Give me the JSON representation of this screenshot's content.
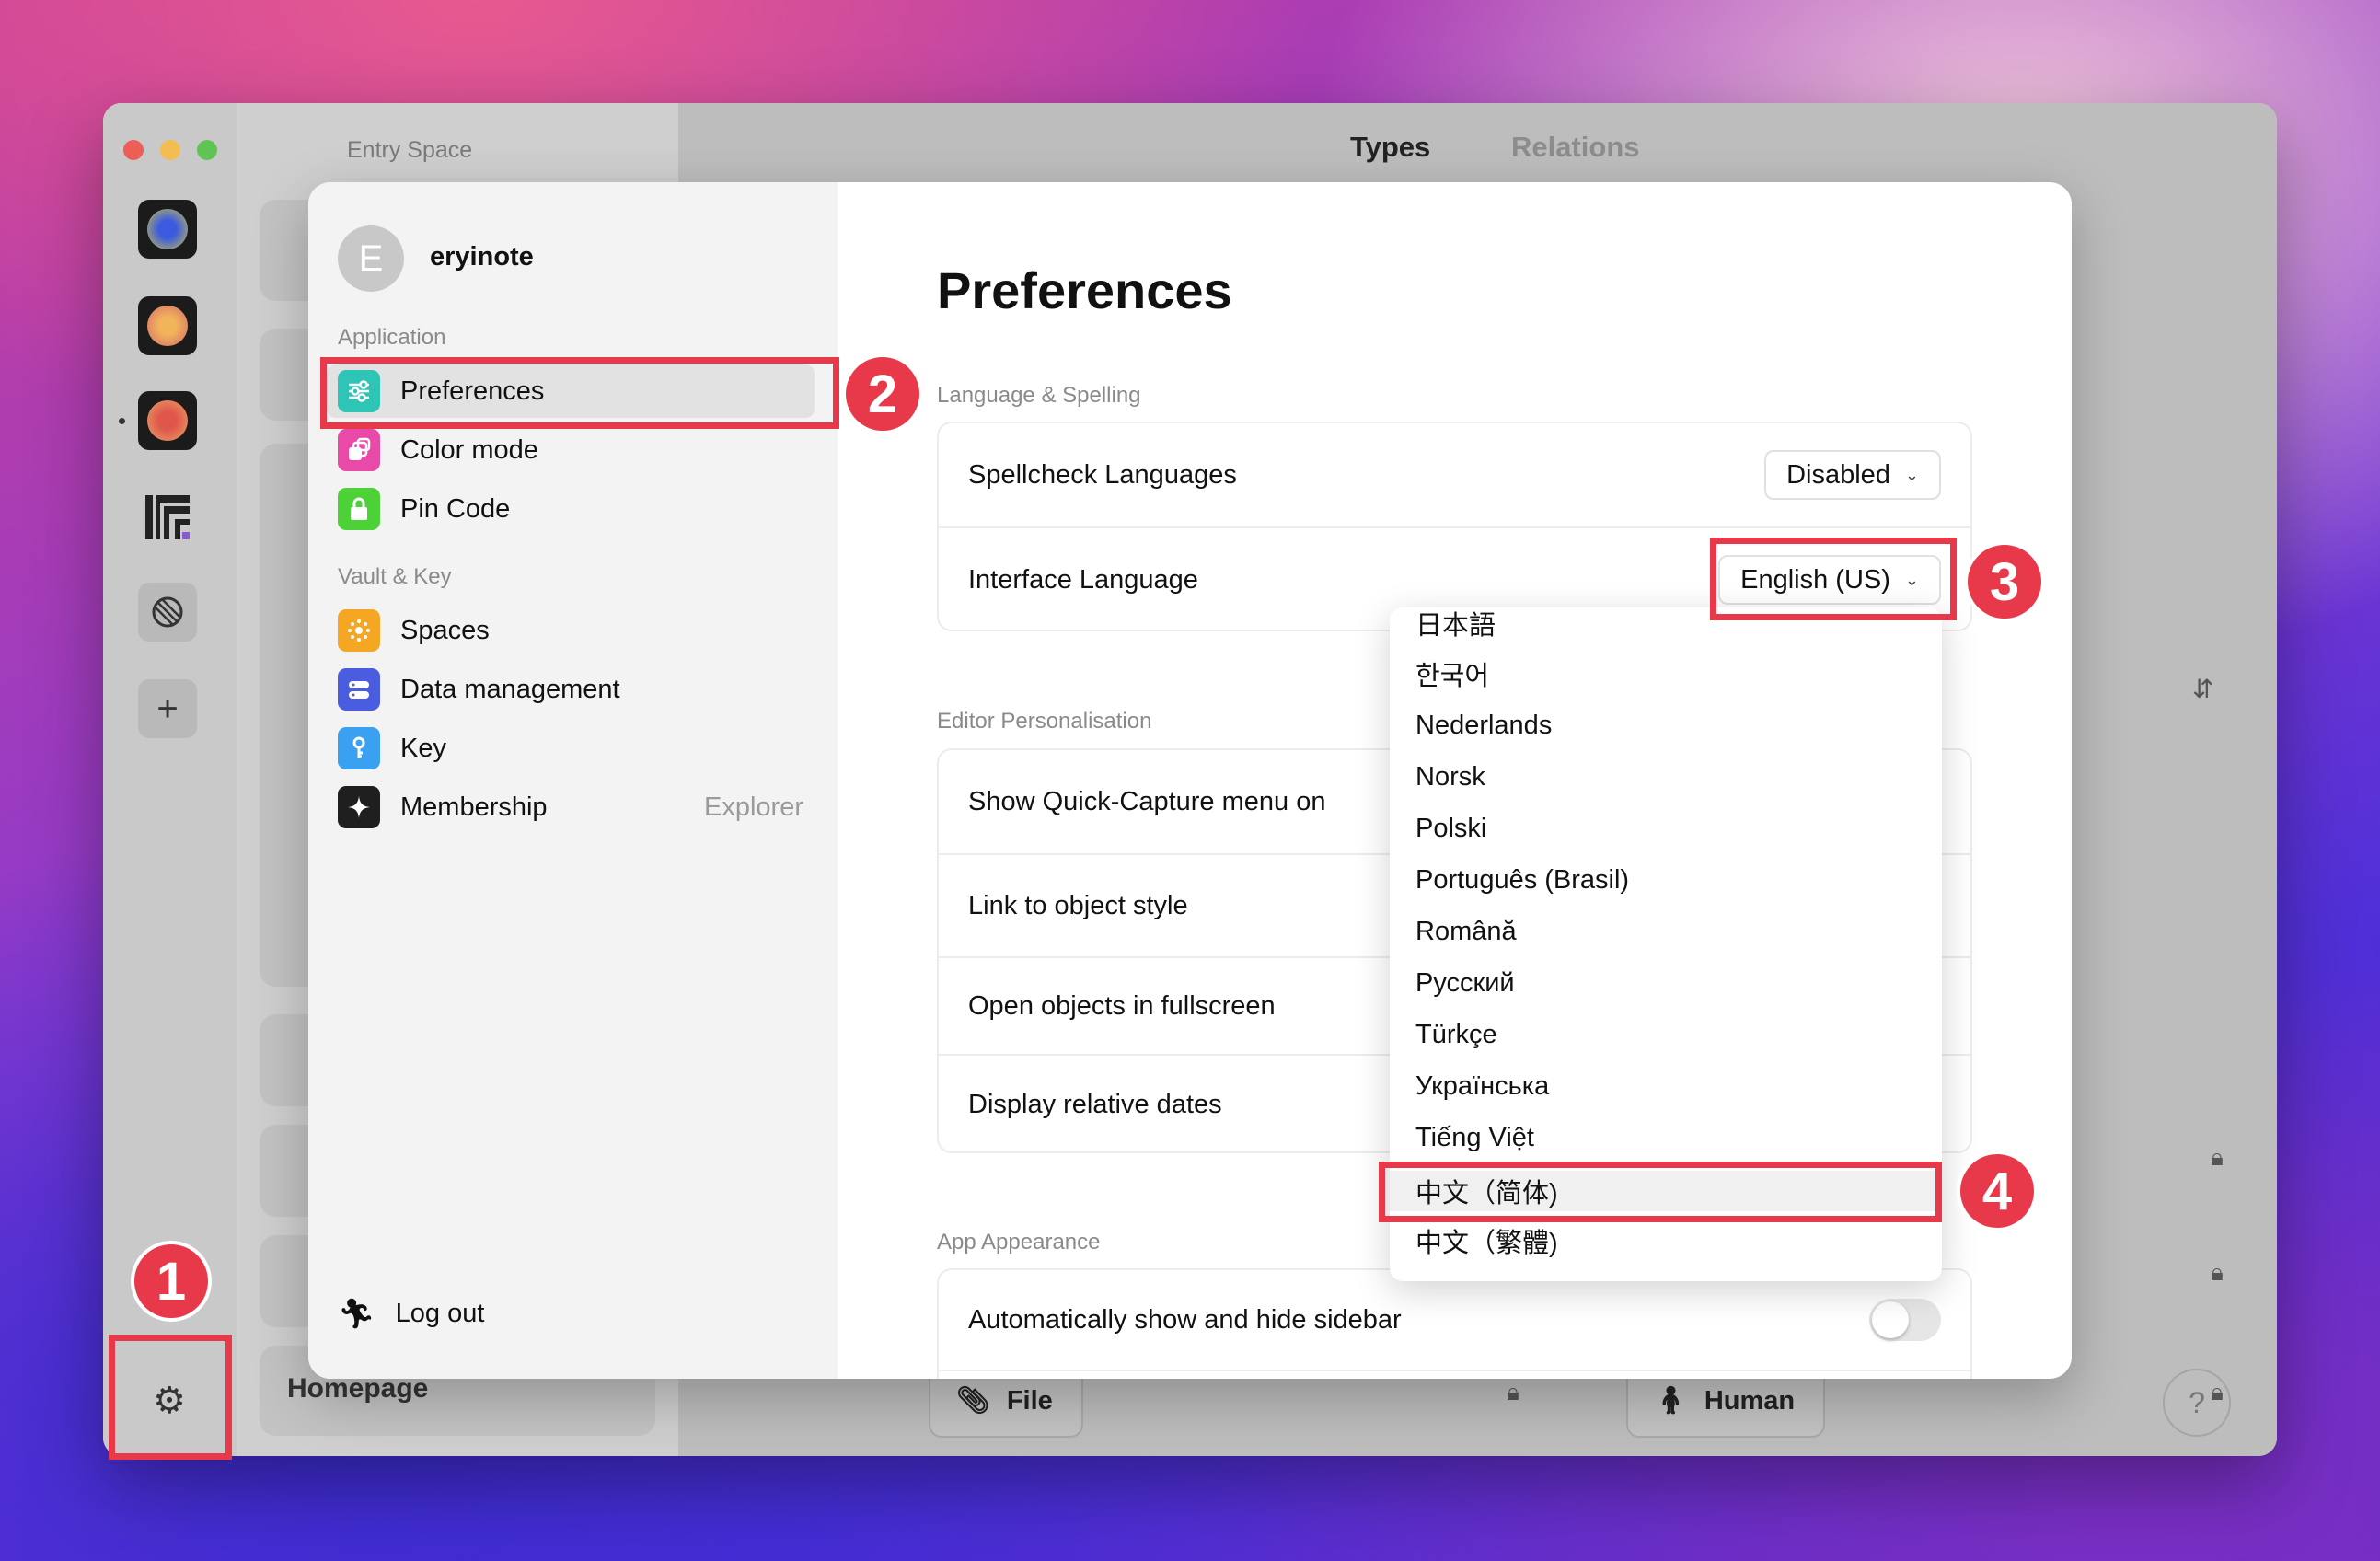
{
  "background_app": {
    "space_title": "Entry Space",
    "tabs": [
      "Types",
      "Relations"
    ],
    "homepage": "Homepage",
    "chips": [
      {
        "icon": "paperclip-icon",
        "label": "File"
      },
      {
        "icon": "person-icon",
        "label": "Human"
      }
    ],
    "help_label": "?"
  },
  "modal": {
    "avatar_letter": "E",
    "username": "eryinote",
    "sections": {
      "application": "Application",
      "vault_key": "Vault & Key"
    },
    "nav": [
      {
        "label": "Preferences",
        "icon": "sliders-icon",
        "color": "#2ec4b6"
      },
      {
        "label": "Color mode",
        "icon": "palette-icon",
        "color": "#e94aa8"
      },
      {
        "label": "Pin Code",
        "icon": "lock-icon",
        "color": "#4cd137"
      },
      {
        "label": "Spaces",
        "icon": "sun-icon",
        "color": "#f5a623"
      },
      {
        "label": "Data management",
        "icon": "database-icon",
        "color": "#4a5de0"
      },
      {
        "label": "Key",
        "icon": "key-icon",
        "color": "#3aa0f0"
      },
      {
        "label": "Membership",
        "icon": "sparkle-icon",
        "color": "#1f1f1f",
        "extra": "Explorer"
      }
    ],
    "logout": "Log out"
  },
  "preferences": {
    "title": "Preferences",
    "language_section": "Language & Spelling",
    "spellcheck_label": "Spellcheck Languages",
    "spellcheck_value": "Disabled",
    "interface_label": "Interface Language",
    "interface_value": "English (US)",
    "editor_section": "Editor Personalisation",
    "editor_rows": [
      "Show Quick-Capture menu on",
      "Link to object style",
      "Open objects in fullscreen",
      "Display relative dates"
    ],
    "appearance_section": "App Appearance",
    "sidebar_toggle_label": "Automatically show and hide sidebar",
    "sidebar_toggle_on": false
  },
  "language_dropdown": {
    "options": [
      "日本語",
      "한국어",
      "Nederlands",
      "Norsk",
      "Polski",
      "Português (Brasil)",
      "Română",
      "Русский",
      "Türkçe",
      "Українська",
      "Tiếng Việt",
      "中文（简体)",
      "中文（繁體)"
    ],
    "highlighted": "中文（简体)"
  },
  "annotations": [
    "1",
    "2",
    "3",
    "4"
  ]
}
